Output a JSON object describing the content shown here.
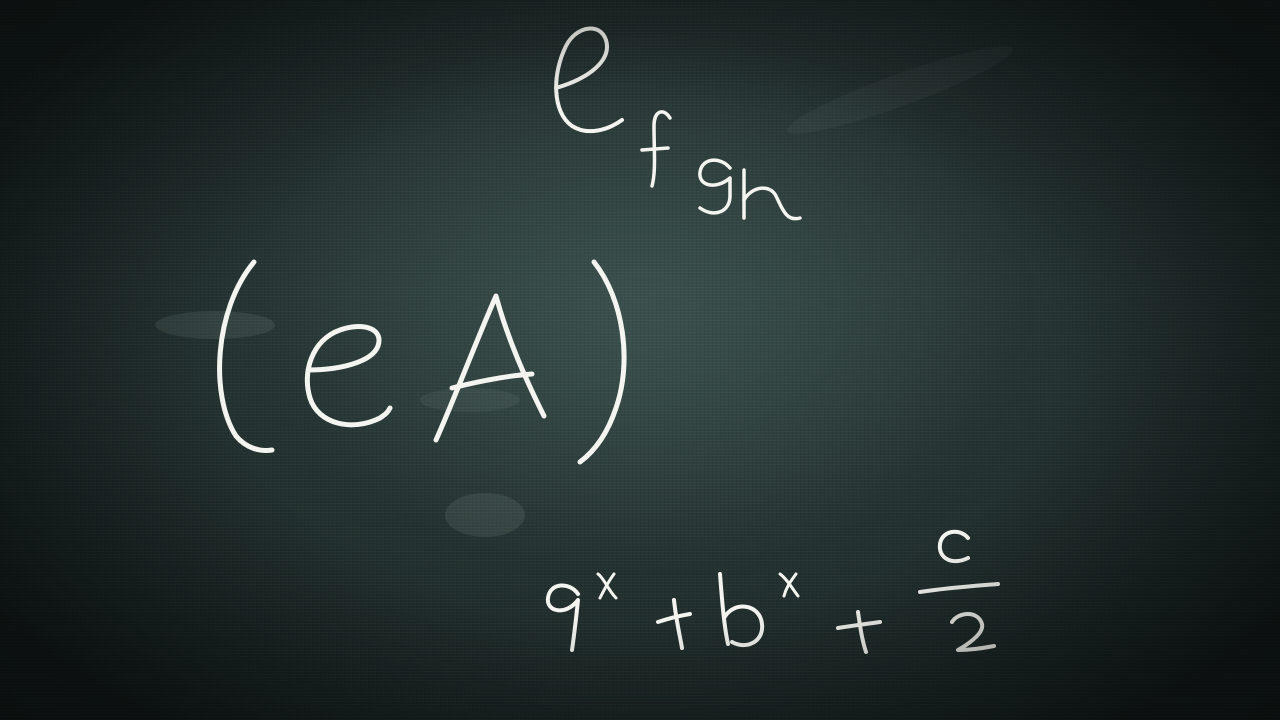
{
  "scene": {
    "surface": "chalkboard",
    "chalk_color": "#f4f4f0",
    "board_color": "#2b3b39"
  },
  "writings": {
    "top": "e f g h",
    "middle": "(eA)",
    "bottom": "a^x + b^x + c/2"
  }
}
